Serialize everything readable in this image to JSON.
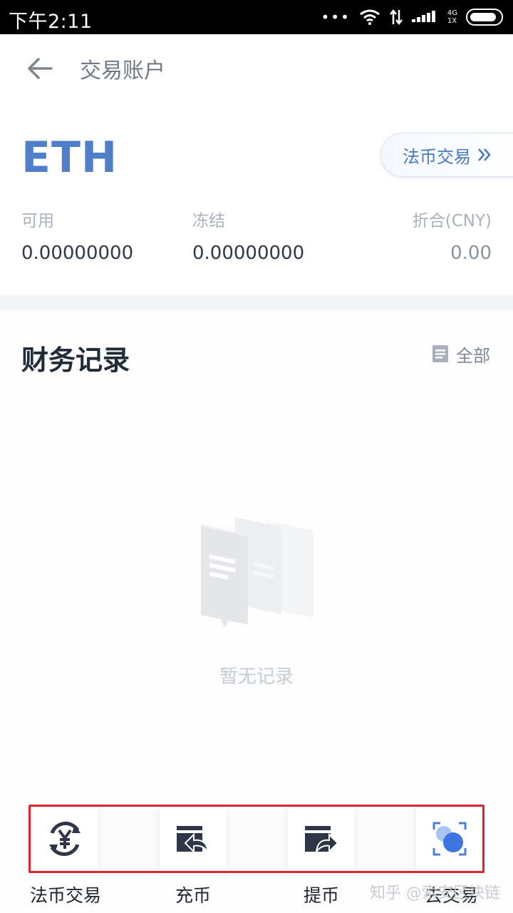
{
  "status_bar": {
    "time": "下午2:11",
    "network_line1": "4G",
    "network_line2": "1X",
    "dots": "•••"
  },
  "nav": {
    "title": "交易账户"
  },
  "account": {
    "coin": "ETH",
    "fiat_button": "法币交易",
    "available_label": "可用",
    "available_value": "0.00000000",
    "frozen_label": "冻结",
    "frozen_value": "0.00000000",
    "converted_label": "折合(CNY)",
    "converted_value": "0.00"
  },
  "records": {
    "title": "财务记录",
    "filter_label": "全部",
    "empty_text": "暂无记录"
  },
  "actions": [
    {
      "label": "法币交易",
      "icon": "yuan-exchange-icon"
    },
    {
      "label": "充币",
      "icon": "deposit-icon"
    },
    {
      "label": "提币",
      "icon": "withdraw-icon"
    },
    {
      "label": "去交易",
      "icon": "trade-icon"
    }
  ],
  "watermark": "知乎 @索安区块链",
  "colors": {
    "accent": "#4f7ecb",
    "highlight": "#d9252b",
    "dark_icon": "#2f3648"
  }
}
